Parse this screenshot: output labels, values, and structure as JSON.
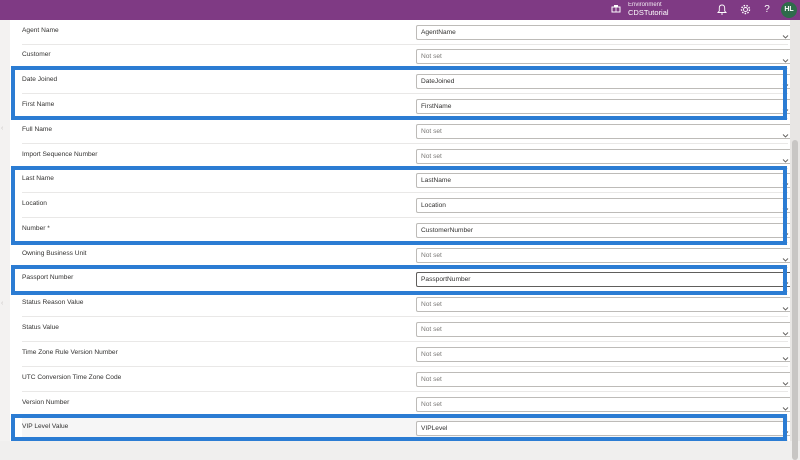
{
  "header": {
    "environment_label": "Environment",
    "environment_name": "CDSTutorial",
    "avatar_initials": "HL"
  },
  "fields": [
    {
      "label": "Agent Name",
      "value": "AgentName",
      "placeholder": false
    },
    {
      "label": "Customer",
      "value": "Not set",
      "placeholder": true
    },
    {
      "label": "Date Joined",
      "value": "DateJoined",
      "placeholder": false
    },
    {
      "label": "First Name",
      "value": "FirstName",
      "placeholder": false
    },
    {
      "label": "Full Name",
      "value": "Not set",
      "placeholder": true
    },
    {
      "label": "Import Sequence Number",
      "value": "Not set",
      "placeholder": true
    },
    {
      "label": "Last Name",
      "value": "LastName",
      "placeholder": false
    },
    {
      "label": "Location",
      "value": "Location",
      "placeholder": false
    },
    {
      "label": "Number *",
      "value": "CustomerNumber",
      "placeholder": false
    },
    {
      "label": "Owning Business Unit",
      "value": "Not set",
      "placeholder": true
    },
    {
      "label": "Passport Number",
      "value": "PassportNumber",
      "placeholder": false
    },
    {
      "label": "Status Reason Value",
      "value": "Not set",
      "placeholder": true
    },
    {
      "label": "Status Value",
      "value": "Not set",
      "placeholder": true
    },
    {
      "label": "Time Zone Rule Version Number",
      "value": "Not set",
      "placeholder": true
    },
    {
      "label": "UTC Conversion Time Zone Code",
      "value": "Not set",
      "placeholder": true
    },
    {
      "label": "Version Number",
      "value": "Not set",
      "placeholder": true
    },
    {
      "label": "VIP Level Value",
      "value": "VIPLevel",
      "placeholder": false
    }
  ],
  "colors": {
    "topbar": "#7f3a84",
    "highlight": "#2b7cd3"
  }
}
